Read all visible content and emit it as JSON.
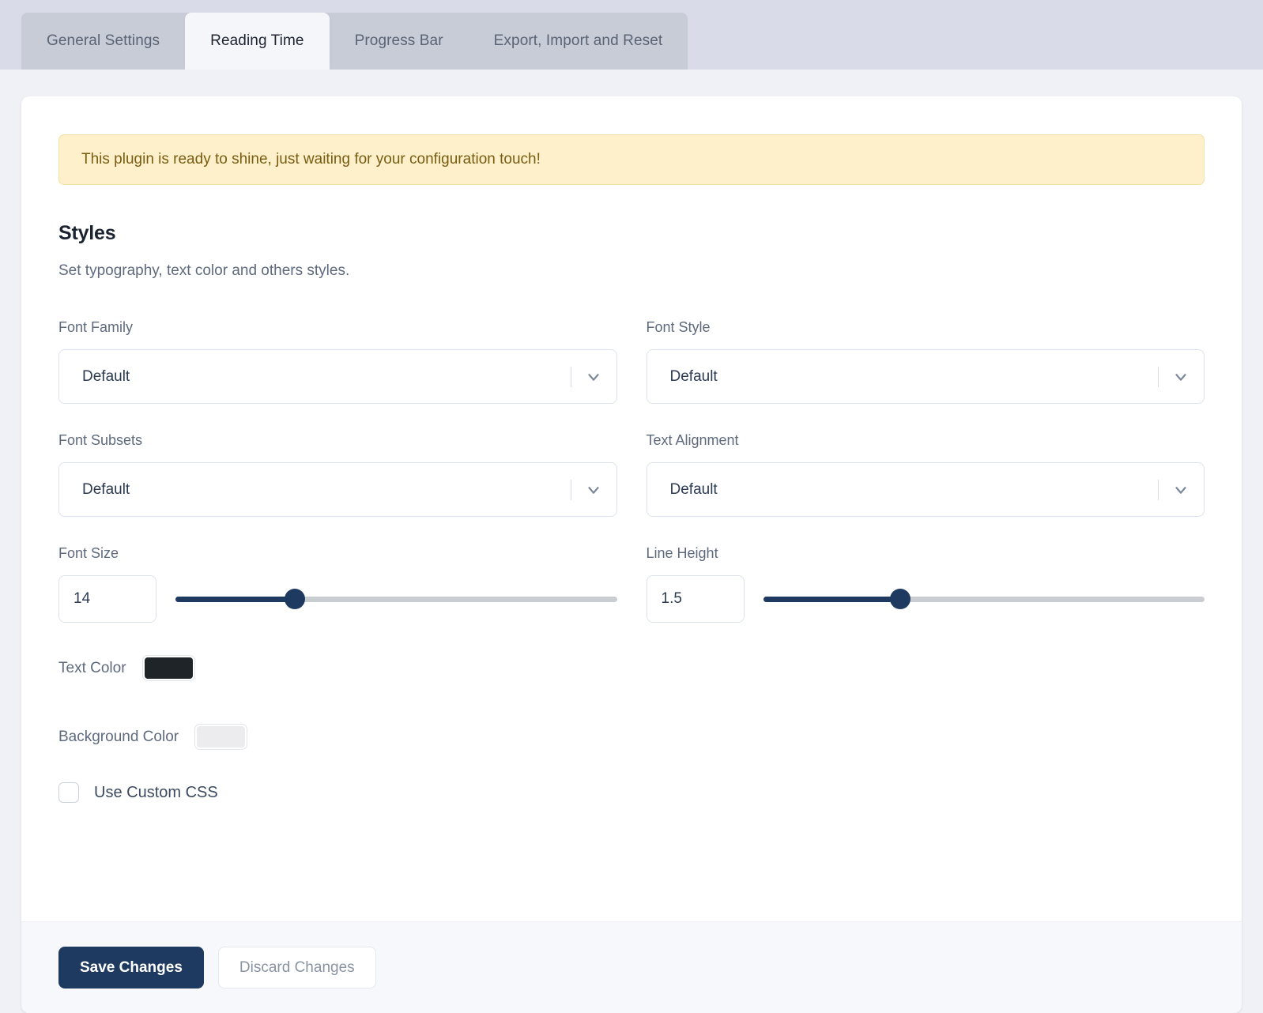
{
  "tabs": [
    {
      "label": "General Settings",
      "active": false
    },
    {
      "label": "Reading Time",
      "active": true
    },
    {
      "label": "Progress Bar",
      "active": false
    },
    {
      "label": "Export, Import and Reset",
      "active": false
    }
  ],
  "notice": {
    "text": "This plugin is ready to shine, just waiting for your configuration touch!",
    "background": "#fdf0cb",
    "border": "#f2e0a8",
    "text_color": "#7a5c11"
  },
  "section": {
    "title": "Styles",
    "description": "Set typography, text color and others styles."
  },
  "fields": {
    "font_family": {
      "label": "Font Family",
      "value": "Default",
      "icon": "chevron-down-icon"
    },
    "font_style": {
      "label": "Font Style",
      "value": "Default",
      "icon": "chevron-down-icon"
    },
    "font_subsets": {
      "label": "Font Subsets",
      "value": "Default",
      "icon": "chevron-down-icon"
    },
    "text_alignment": {
      "label": "Text Alignment",
      "value": "Default",
      "icon": "chevron-down-icon"
    },
    "font_size": {
      "label": "Font Size",
      "value": "14",
      "slider_percent": 27
    },
    "line_height": {
      "label": "Line Height",
      "value": "1.5",
      "slider_percent": 31
    },
    "text_color": {
      "label": "Text Color",
      "value": "#1f2429"
    },
    "background_color": {
      "label": "Background Color",
      "value": "#ececee"
    },
    "use_custom_css": {
      "label": "Use Custom CSS",
      "checked": false
    }
  },
  "footer": {
    "save_label": "Save Changes",
    "discard_label": "Discard Changes",
    "save_color": "#1f3a60"
  },
  "theme": {
    "page_background": "#eff1f6",
    "tabstrip_background": "#d9dbe8",
    "tabs_background": "#c8ccd7",
    "active_tab_background": "#f4f6fa",
    "accent": "#1f3a60",
    "slider_track": "#c9ccd0"
  }
}
